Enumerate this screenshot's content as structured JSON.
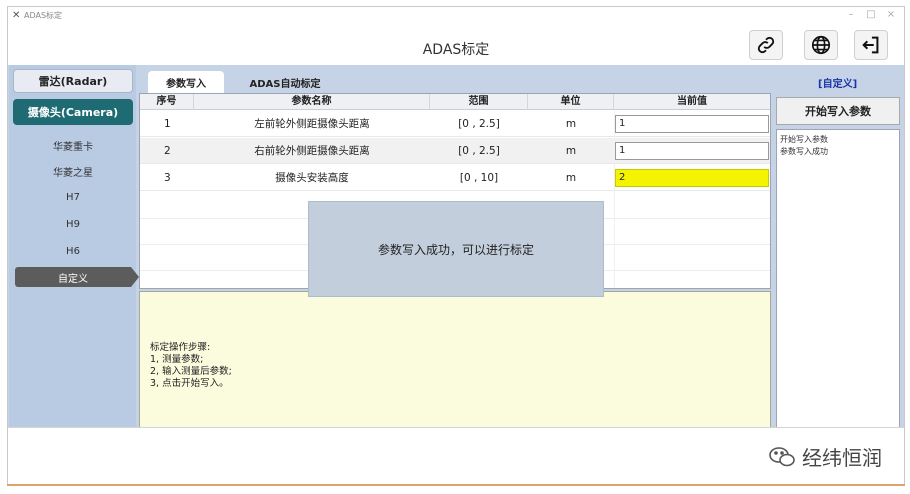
{
  "window": {
    "small_title": "ADAS标定",
    "controls": [
      "–",
      "□",
      "×"
    ]
  },
  "header": {
    "title": "ADAS标定",
    "buttons": [
      "link-icon",
      "globe-icon",
      "exit-icon"
    ]
  },
  "sidebar": {
    "radar": "雷达(Radar)",
    "camera": "摄像头(Camera)",
    "items": [
      "华菱重卡",
      "华菱之星",
      "H7",
      "H9",
      "H6",
      "自定义"
    ],
    "active_index": 5
  },
  "tabs": [
    {
      "label": "参数写入",
      "active": true
    },
    {
      "label": "ADAS自动标定",
      "active": false
    }
  ],
  "custom_link": "[自定义]",
  "table": {
    "headers": [
      "序号",
      "参数名称",
      "范围",
      "单位",
      "当前值"
    ],
    "rows": [
      {
        "idx": "1",
        "name": "左前轮外侧距摄像头距离",
        "range": "[0 , 2.5]",
        "unit": "m",
        "value": "1"
      },
      {
        "idx": "2",
        "name": "右前轮外侧距摄像头距离",
        "range": "[0 , 2.5]",
        "unit": "m",
        "value": "1"
      },
      {
        "idx": "3",
        "name": "摄像头安装高度",
        "range": "[0 , 10]",
        "unit": "m",
        "value": "2"
      }
    ]
  },
  "instructions": [
    "标定操作步骤:",
    "1, 测量参数;",
    "2, 输入测量后参数;",
    "3, 点击开始写入。"
  ],
  "right_panel": {
    "start_button": "开始写入参数",
    "log": [
      "开始写入参数",
      "参数写入成功"
    ]
  },
  "popup": {
    "message": "参数写入成功，可以进行标定"
  },
  "watermark": {
    "text": "经纬恒润"
  },
  "colors": {
    "sidebar_bg": "#b9cae3",
    "camera_active": "#1f6b74",
    "highlight_input": "#f4f400",
    "instructions_bg": "#fbfbde",
    "link_blue": "#1a33a8"
  }
}
